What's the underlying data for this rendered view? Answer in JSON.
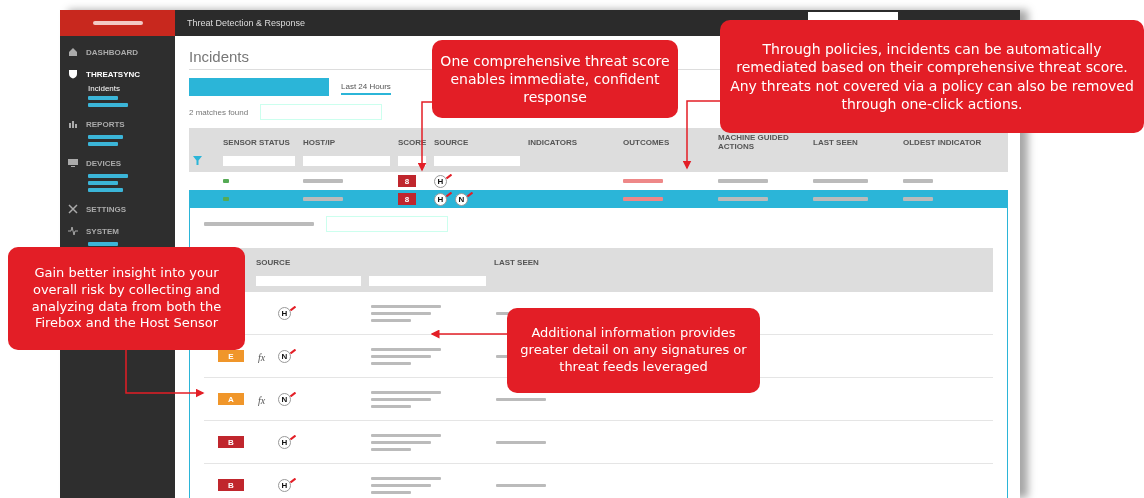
{
  "header": {
    "title": "Threat Detection & Response"
  },
  "sidebar": {
    "items": [
      {
        "label": "DASHBOARD",
        "selected": false
      },
      {
        "label": "THREATSYNC",
        "selected": true,
        "children": [
          {
            "label": "Incidents",
            "selected": true
          }
        ]
      },
      {
        "label": "REPORTS",
        "selected": false
      },
      {
        "label": "DEVICES",
        "selected": false
      },
      {
        "label": "SETTINGS",
        "selected": false
      },
      {
        "label": "SYSTEM",
        "selected": false
      }
    ]
  },
  "page": {
    "title": "Incidents",
    "time_tabs": [
      {
        "label": "Last 24 Hours",
        "selected": true
      }
    ],
    "matches": "2 matches found"
  },
  "table": {
    "columns": [
      "SENSOR STATUS",
      "HOST/IP",
      "SCORE",
      "SOURCE",
      "INDICATORS",
      "OUTCOMES",
      "MACHINE GUIDED ACTIONS",
      "LAST SEEN",
      "OLDEST INDICATOR"
    ],
    "rows": [
      {
        "selected": false,
        "score": "8",
        "color": "#c0262d",
        "sources": [
          "H"
        ]
      },
      {
        "selected": true,
        "score": "8",
        "color": "#c0262d",
        "sources": [
          "H",
          "N"
        ]
      }
    ]
  },
  "detail": {
    "columns": [
      "SOURCE",
      "LAST SEEN"
    ],
    "rows": [
      {
        "source": "H"
      },
      {
        "score": "E",
        "color": "#f0962a",
        "formula": "fx",
        "source": "N"
      },
      {
        "score": "A",
        "color": "#f0962a",
        "formula": "fx",
        "source": "N"
      },
      {
        "score": "B",
        "color": "#c0262d",
        "source": "H"
      },
      {
        "score": "B",
        "color": "#c0262d",
        "source": "H"
      }
    ]
  },
  "callouts": [
    {
      "text": "One comprehensive threat score enables immediate, confident response"
    },
    {
      "text": "Through policies, incidents can be automatically remediated based on their comprehensive threat score. Any threats not covered via a policy can also be removed through one-click actions."
    },
    {
      "text": "Gain better insight into your overall risk by collecting and analyzing data from both the Firebox and the Host Sensor"
    },
    {
      "text": "Additional information provides greater detail on any signatures or threat feeds leveraged"
    }
  ]
}
